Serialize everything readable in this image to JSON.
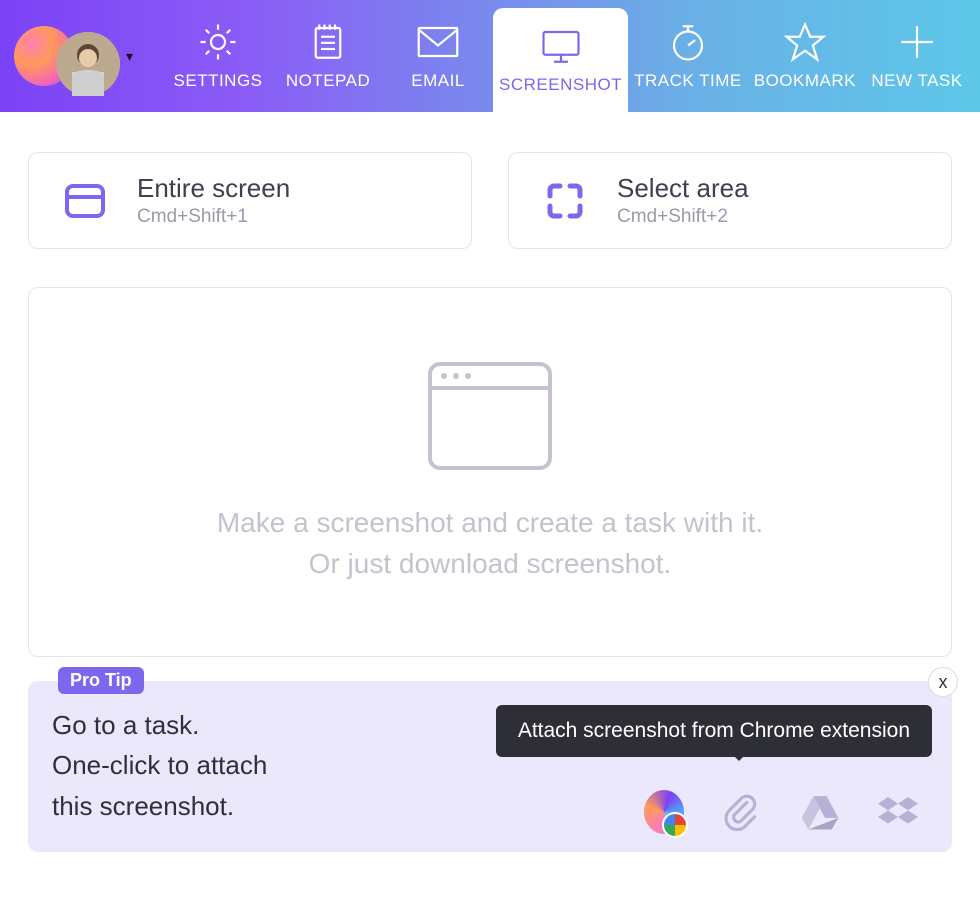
{
  "nav": {
    "items": [
      {
        "label": "SETTINGS"
      },
      {
        "label": "NOTEPAD"
      },
      {
        "label": "EMAIL"
      },
      {
        "label": "SCREENSHOT"
      },
      {
        "label": "TRACK TIME"
      },
      {
        "label": "BOOKMARK"
      },
      {
        "label": "NEW TASK"
      }
    ]
  },
  "capture": {
    "entire": {
      "title": "Entire screen",
      "shortcut": "Cmd+Shift+1"
    },
    "area": {
      "title": "Select area",
      "shortcut": "Cmd+Shift+2"
    }
  },
  "dropzone": {
    "line1": "Make a screenshot and create a task with it.",
    "line2": "Or just download screenshot."
  },
  "protip": {
    "badge": "Pro Tip",
    "line1": "Go to a task.",
    "line2": "One-click to attach",
    "line3": "this screenshot.",
    "tooltip": "Attach screenshot from Chrome extension",
    "close": "x"
  }
}
